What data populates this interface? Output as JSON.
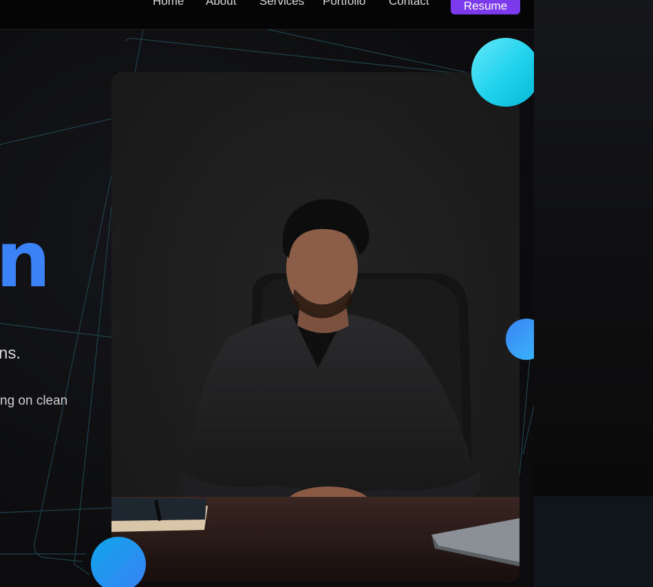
{
  "nav": {
    "items": [
      {
        "label": "Home"
      },
      {
        "label": "About"
      },
      {
        "label": "Services"
      },
      {
        "label": "Portfolio"
      },
      {
        "label": "Contact"
      }
    ],
    "resume_label": "Resume"
  },
  "hero": {
    "name_fragment": "n",
    "tagline_fragment": "ns.",
    "description_fragment": "ng on clean"
  },
  "photo": {
    "subject": "person-at-desk"
  },
  "colors": {
    "accent_blue": "#3b82f6",
    "accent_purple": "#7c3aed",
    "accent_cyan": "#22d3ee",
    "background": "#0b0b0d"
  }
}
